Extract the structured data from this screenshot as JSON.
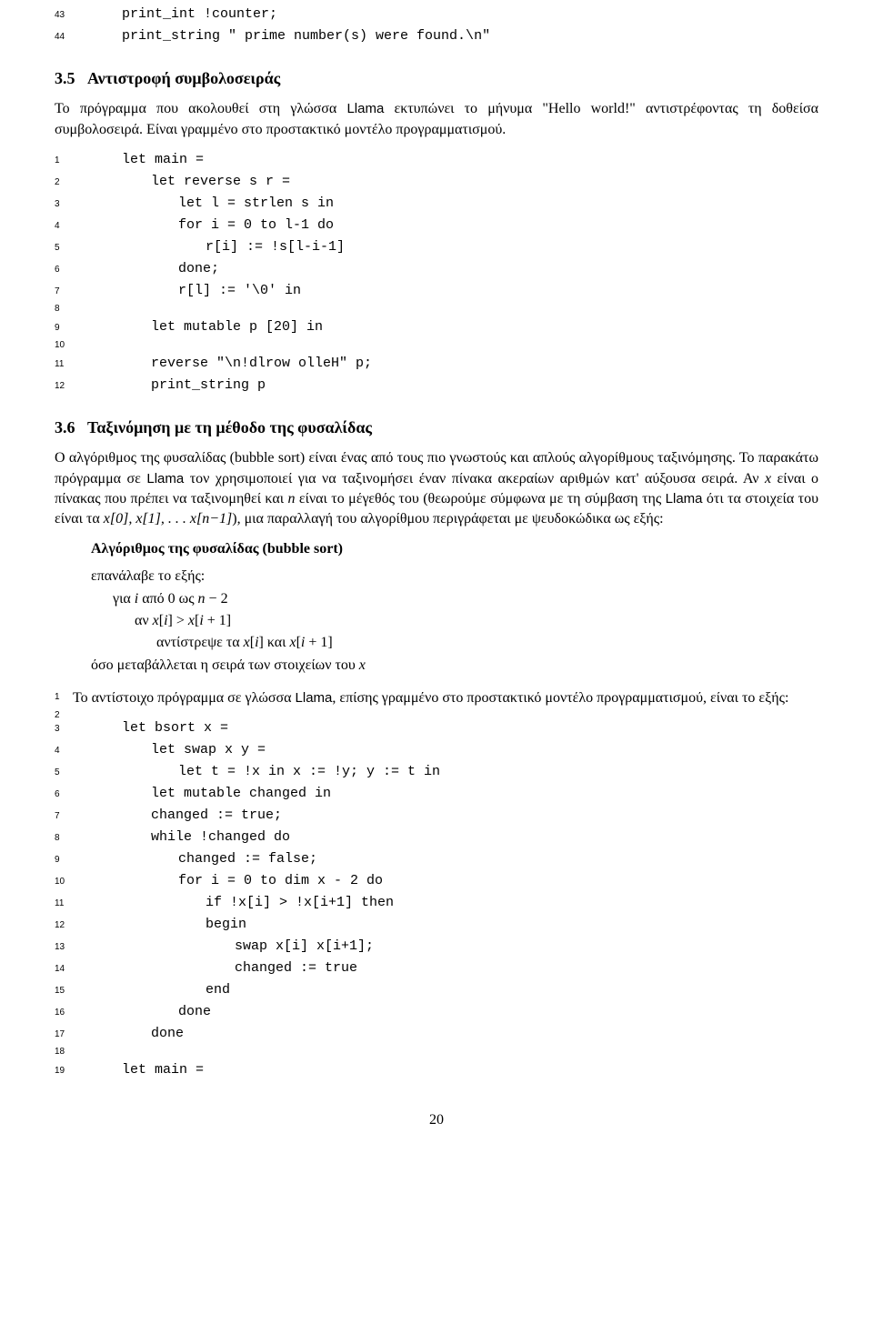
{
  "code1": {
    "lines": [
      {
        "n": "43",
        "indent": "ind1",
        "text": "print_int !counter;"
      },
      {
        "n": "44",
        "indent": "ind1",
        "text": "print_string \" prime number(s) were found.\\n\""
      }
    ]
  },
  "section35": {
    "number": "3.5",
    "title": "Αντιστροφή συμβολοσειράς",
    "para1a": "Το πρόγραμμα που ακολουθεί στη γλώσσα ",
    "para1b": " εκτυπώνει το μήνυμα \"Hello world!\" αντιστρέφοντας τη δοθείσα συμβολοσειρά. Είναι γραμμένο στο προστακτικό μοντέλο προγραμματισμού.",
    "llama": "Llama"
  },
  "code2": {
    "lines": [
      {
        "n": "1",
        "indent": "ind1",
        "text": "let main ="
      },
      {
        "n": "2",
        "indent": "ind2",
        "text": "let reverse s r ="
      },
      {
        "n": "3",
        "indent": "ind3",
        "text": "let l = strlen s in"
      },
      {
        "n": "4",
        "indent": "ind3",
        "text": "for i = 0 to l-1 do"
      },
      {
        "n": "5",
        "indent": "ind4",
        "text": "r[i] := !s[l-i-1]"
      },
      {
        "n": "6",
        "indent": "ind3",
        "text": "done;"
      },
      {
        "n": "7",
        "indent": "ind3",
        "text": "r[l] := '\\0' in"
      },
      {
        "n": "8",
        "indent": "ind1",
        "text": ""
      },
      {
        "n": "9",
        "indent": "ind2",
        "text": "let mutable p [20] in"
      },
      {
        "n": "10",
        "indent": "ind1",
        "text": ""
      },
      {
        "n": "11",
        "indent": "ind2",
        "text": "reverse \"\\n!dlrow olleH\" p;"
      },
      {
        "n": "12",
        "indent": "ind2",
        "text": "print_string p"
      }
    ]
  },
  "section36": {
    "number": "3.6",
    "title": "Ταξινόμηση με τη μέθοδο της φυσαλίδας",
    "para1a": "Ο αλγόριθμος της φυσαλίδας (bubble sort) είναι ένας από τους πιο γνωστούς και απλούς αλγορίθμους ταξινόμησης. Το παρακάτω πρόγραμμα σε ",
    "para1b": " τον χρησιμοποιεί για να ταξινομήσει έναν πίνακα ακεραίων αριθμών κατ' αύξουσα σειρά. Αν ",
    "para1c": " είναι ο πίνακας που πρέπει να ταξινομηθεί και ",
    "para1d": " είναι το μέγεθός του (θεωρούμε σύμφωνα με τη σύμβαση της ",
    "para1e": " ότι τα στοιχεία του είναι τα ",
    "para1f": "), μια παραλλαγή του αλγορίθμου περιγράφεται με ψευδοκώδικα ως εξής:",
    "llama": "Llama",
    "x": "x",
    "n": "n",
    "arr": "x[0], x[1], . . . x[n−1]",
    "para2a": "Το αντίστοιχο πρόγραμμα σε γλώσσα ",
    "para2b": ", επίσης γραμμένο στο προστακτικό μοντέλο προγραμματισμού, είναι το εξής:"
  },
  "algo": {
    "title": "Αλγόριθμος της φυσαλίδας (bubble sort)",
    "lines": [
      {
        "indent": "algind0",
        "text": "επανάλαβε το εξής:"
      },
      {
        "indent": "algind1",
        "text_html": "για <span class='math'>i</span> από 0 ως <span class='math'>n</span> − 2"
      },
      {
        "indent": "algind2",
        "text_html": "αν <span class='math'>x</span>[<span class='math'>i</span>] &gt; <span class='math'>x</span>[<span class='math'>i</span> + 1]"
      },
      {
        "indent": "algind3",
        "text_html": "αντίστρεψε τα <span class='math'>x</span>[<span class='math'>i</span>] και <span class='math'>x</span>[<span class='math'>i</span> + 1]"
      },
      {
        "indent": "algind0",
        "text_html": "όσο μεταβάλλεται η σειρά των στοιχείων του <span class='math'>x</span>"
      }
    ]
  },
  "code3": {
    "intro_lines": [
      "1",
      "2"
    ],
    "lines": [
      {
        "n": "3",
        "indent": "ind1",
        "text": "let bsort x ="
      },
      {
        "n": "4",
        "indent": "ind2",
        "text": "let swap x y ="
      },
      {
        "n": "5",
        "indent": "ind3",
        "text": "let t = !x in x := !y; y := t in"
      },
      {
        "n": "6",
        "indent": "ind2",
        "text": "let mutable changed in"
      },
      {
        "n": "7",
        "indent": "ind2",
        "text": "changed := true;"
      },
      {
        "n": "8",
        "indent": "ind2",
        "text": "while !changed do"
      },
      {
        "n": "9",
        "indent": "ind3",
        "text": "changed := false;"
      },
      {
        "n": "10",
        "indent": "ind3",
        "text": "for i = 0 to dim x - 2 do"
      },
      {
        "n": "11",
        "indent": "ind4",
        "text": "if !x[i] > !x[i+1] then"
      },
      {
        "n": "12",
        "indent": "ind4",
        "text": "begin"
      },
      {
        "n": "13",
        "indent": "ind5",
        "text": "swap x[i] x[i+1];"
      },
      {
        "n": "14",
        "indent": "ind5",
        "text": "changed := true"
      },
      {
        "n": "15",
        "indent": "ind4",
        "text": "end"
      },
      {
        "n": "16",
        "indent": "ind3",
        "text": "done"
      },
      {
        "n": "17",
        "indent": "ind2",
        "text": "done"
      },
      {
        "n": "18",
        "indent": "ind1",
        "text": ""
      },
      {
        "n": "19",
        "indent": "ind1",
        "text": "let main ="
      }
    ]
  },
  "page_number": "20"
}
